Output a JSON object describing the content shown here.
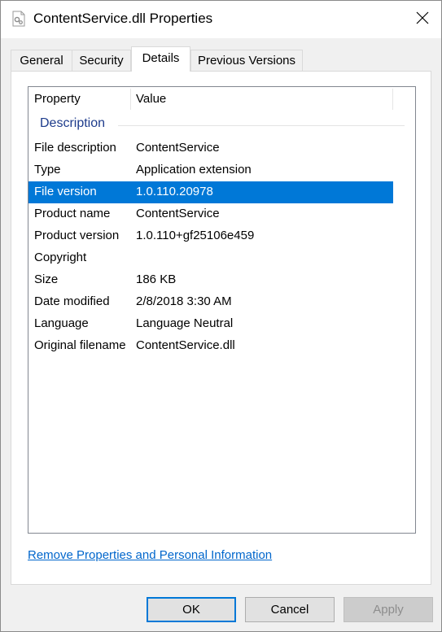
{
  "window": {
    "title": "ContentService.dll Properties"
  },
  "tabs": [
    {
      "label": "General"
    },
    {
      "label": "Security"
    },
    {
      "label": "Details",
      "active": true
    },
    {
      "label": "Previous Versions"
    }
  ],
  "details": {
    "columns": {
      "property": "Property",
      "value": "Value"
    },
    "group": "Description",
    "rows": [
      {
        "property": "File description",
        "value": "ContentService"
      },
      {
        "property": "Type",
        "value": "Application extension"
      },
      {
        "property": "File version",
        "value": "1.0.110.20978",
        "selected": true
      },
      {
        "property": "Product name",
        "value": "ContentService"
      },
      {
        "property": "Product version",
        "value": "1.0.110+gf25106e459"
      },
      {
        "property": "Copyright",
        "value": ""
      },
      {
        "property": "Size",
        "value": "186 KB"
      },
      {
        "property": "Date modified",
        "value": "2/8/2018 3:30 AM"
      },
      {
        "property": "Language",
        "value": "Language Neutral"
      },
      {
        "property": "Original filename",
        "value": "ContentService.dll"
      }
    ]
  },
  "link": {
    "remove_label": "Remove Properties and Personal Information"
  },
  "buttons": {
    "ok": "OK",
    "cancel": "Cancel",
    "apply": "Apply"
  },
  "colors": {
    "selection": "#0078d7",
    "link": "#0066cc",
    "group_header": "#1e3c8c"
  },
  "icons": {
    "title": "dll-file-icon",
    "close": "close-icon"
  }
}
